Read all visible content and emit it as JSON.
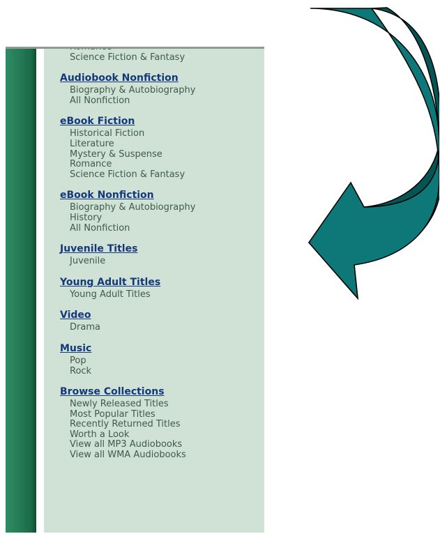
{
  "sections": [
    {
      "heading": "",
      "items": [
        "Romance",
        "Science Fiction & Fantasy"
      ]
    },
    {
      "heading": "Audiobook Nonfiction",
      "items": [
        "Biography & Autobiography",
        "All Nonfiction"
      ]
    },
    {
      "heading": "eBook Fiction",
      "items": [
        "Historical Fiction",
        "Literature",
        "Mystery & Suspense",
        "Romance",
        "Science Fiction & Fantasy"
      ]
    },
    {
      "heading": "eBook Nonfiction",
      "items": [
        "Biography & Autobiography",
        "History",
        "All Nonfiction"
      ]
    },
    {
      "heading": "Juvenile Titles",
      "items": [
        "Juvenile"
      ]
    },
    {
      "heading": "Young Adult Titles",
      "items": [
        "Young Adult Titles"
      ]
    },
    {
      "heading": "Video",
      "items": [
        "Drama"
      ]
    },
    {
      "heading": "Music",
      "items": [
        "Pop",
        "Rock"
      ]
    },
    {
      "heading": "Browse Collections",
      "items": [
        "Newly Released Titles",
        "Most Popular Titles",
        "Recently Returned Titles",
        "Worth a Look",
        "View all MP3 Audiobooks",
        "View all WMA Audiobooks"
      ]
    }
  ],
  "colors": {
    "heading_link": "#14387a",
    "item_text": "#3f5a4c",
    "nav_background": "#d0e2d6",
    "sidebar_green": "#237a55",
    "arrow_fill": "#0e7778",
    "arrow_shadow": "#075454"
  },
  "icons": {
    "arrow": "curved-down-left-arrow-icon"
  }
}
